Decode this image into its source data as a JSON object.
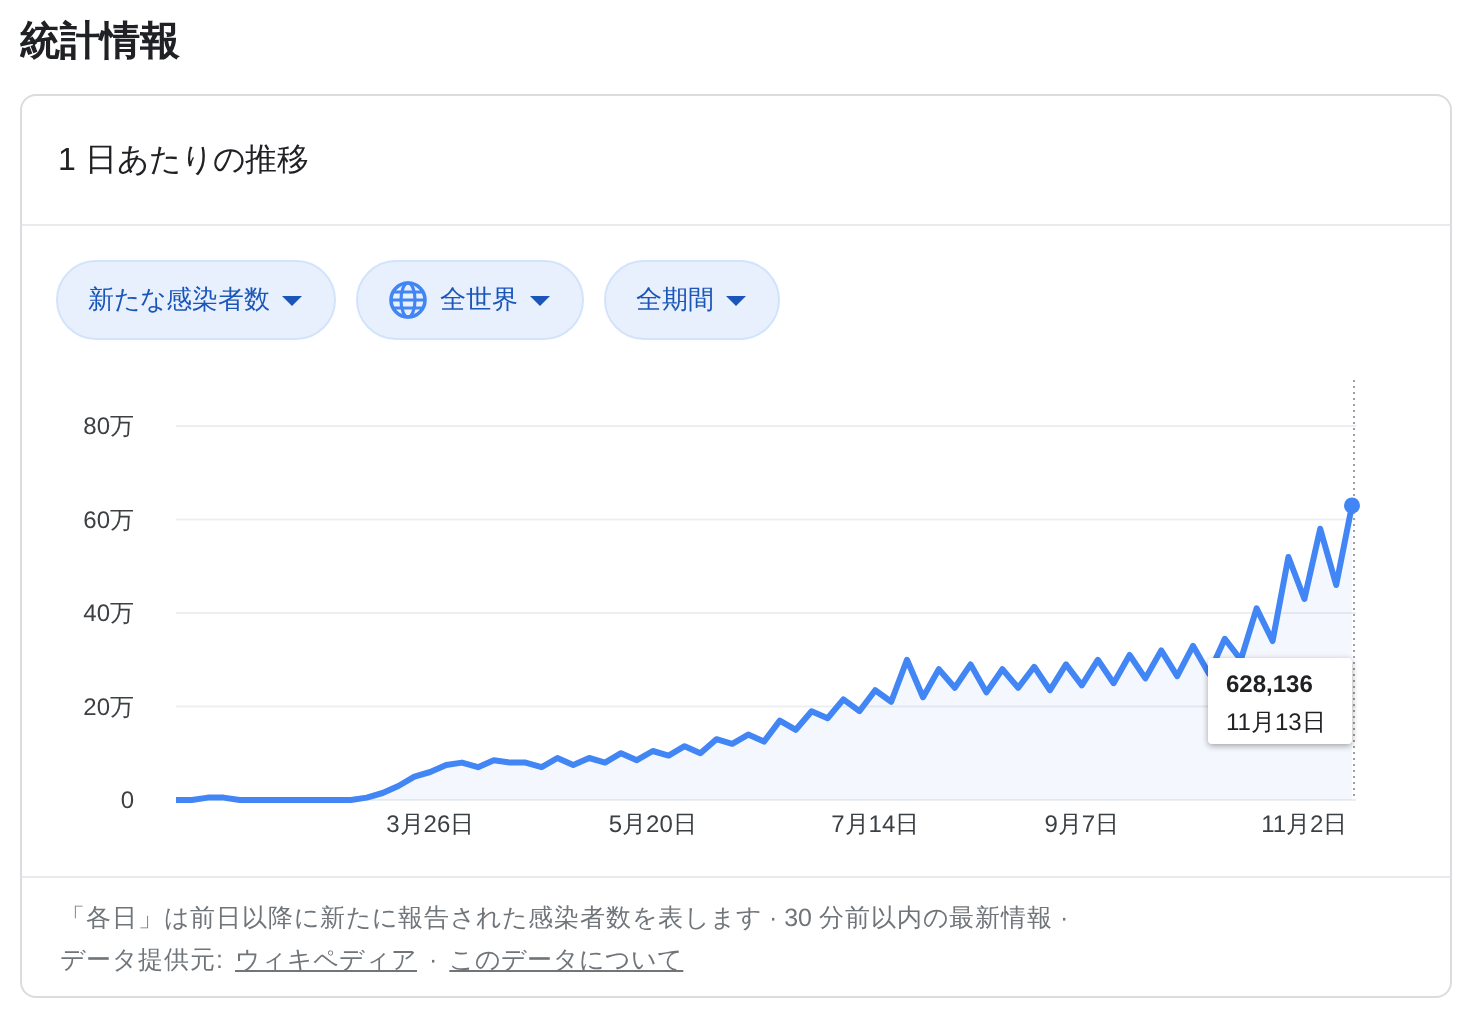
{
  "page_title": "統計情報",
  "card": {
    "title": "1 日あたりの推移",
    "filters": [
      {
        "label": "新たな感染者数",
        "kind": "plain"
      },
      {
        "label": "全世界",
        "kind": "region"
      },
      {
        "label": "全期間",
        "kind": "plain"
      }
    ],
    "chart_data": {
      "type": "line",
      "categories": [
        null,
        null,
        null,
        null,
        null,
        null,
        null,
        null,
        null,
        null,
        null,
        null,
        null,
        null,
        null,
        null,
        "3月26日",
        null,
        null,
        null,
        null,
        null,
        null,
        null,
        null,
        null,
        null,
        null,
        null,
        null,
        "5月20日",
        null,
        null,
        null,
        null,
        null,
        null,
        null,
        null,
        null,
        null,
        null,
        null,
        null,
        "7月14日",
        null,
        null,
        null,
        null,
        null,
        null,
        null,
        null,
        null,
        null,
        null,
        null,
        "9月7日",
        null,
        null,
        null,
        null,
        null,
        null,
        null,
        null,
        null,
        null,
        null,
        null,
        null,
        "11月2日",
        null,
        null,
        null
      ],
      "series": [
        {
          "color": "#4285f4",
          "values": [
            0,
            0,
            0.5,
            0.5,
            0,
            0,
            0,
            0,
            0,
            0,
            0,
            0,
            0.5,
            1.5,
            3,
            5,
            6,
            7.5,
            8,
            7,
            8.5,
            8,
            8,
            7,
            9,
            7.5,
            9,
            8,
            10,
            8.5,
            10.5,
            9.5,
            11.5,
            10,
            13,
            12,
            14,
            12.5,
            17,
            15,
            19,
            17.5,
            21.5,
            19,
            23.5,
            21,
            30,
            22,
            28,
            24,
            29,
            23,
            28,
            24,
            28.5,
            23.5,
            29,
            24.5,
            30,
            25,
            31,
            26,
            32,
            26.5,
            33,
            27,
            34.5,
            30,
            41,
            34,
            52,
            43,
            58,
            46,
            63
          ]
        }
      ],
      "ylim": [
        0,
        80
      ],
      "grid": true,
      "yticks": [
        0,
        {
          "value": 20,
          "label": "20万"
        },
        {
          "value": 40,
          "label": "40万"
        },
        {
          "value": 60,
          "label": "60万"
        },
        {
          "value": 80,
          "label": "80万"
        }
      ]
    },
    "tooltip": {
      "value": "628,136",
      "date": "11月13日"
    },
    "footer": {
      "note": "「各日」は前日以降に新たに報告された感染者数を表します · 30 分前以内の最新情報 ·",
      "source_label": "データ提供元:",
      "links": [
        {
          "label": "ウィキペディア"
        },
        {
          "label": "このデータについて"
        }
      ],
      "separator": "·"
    }
  }
}
